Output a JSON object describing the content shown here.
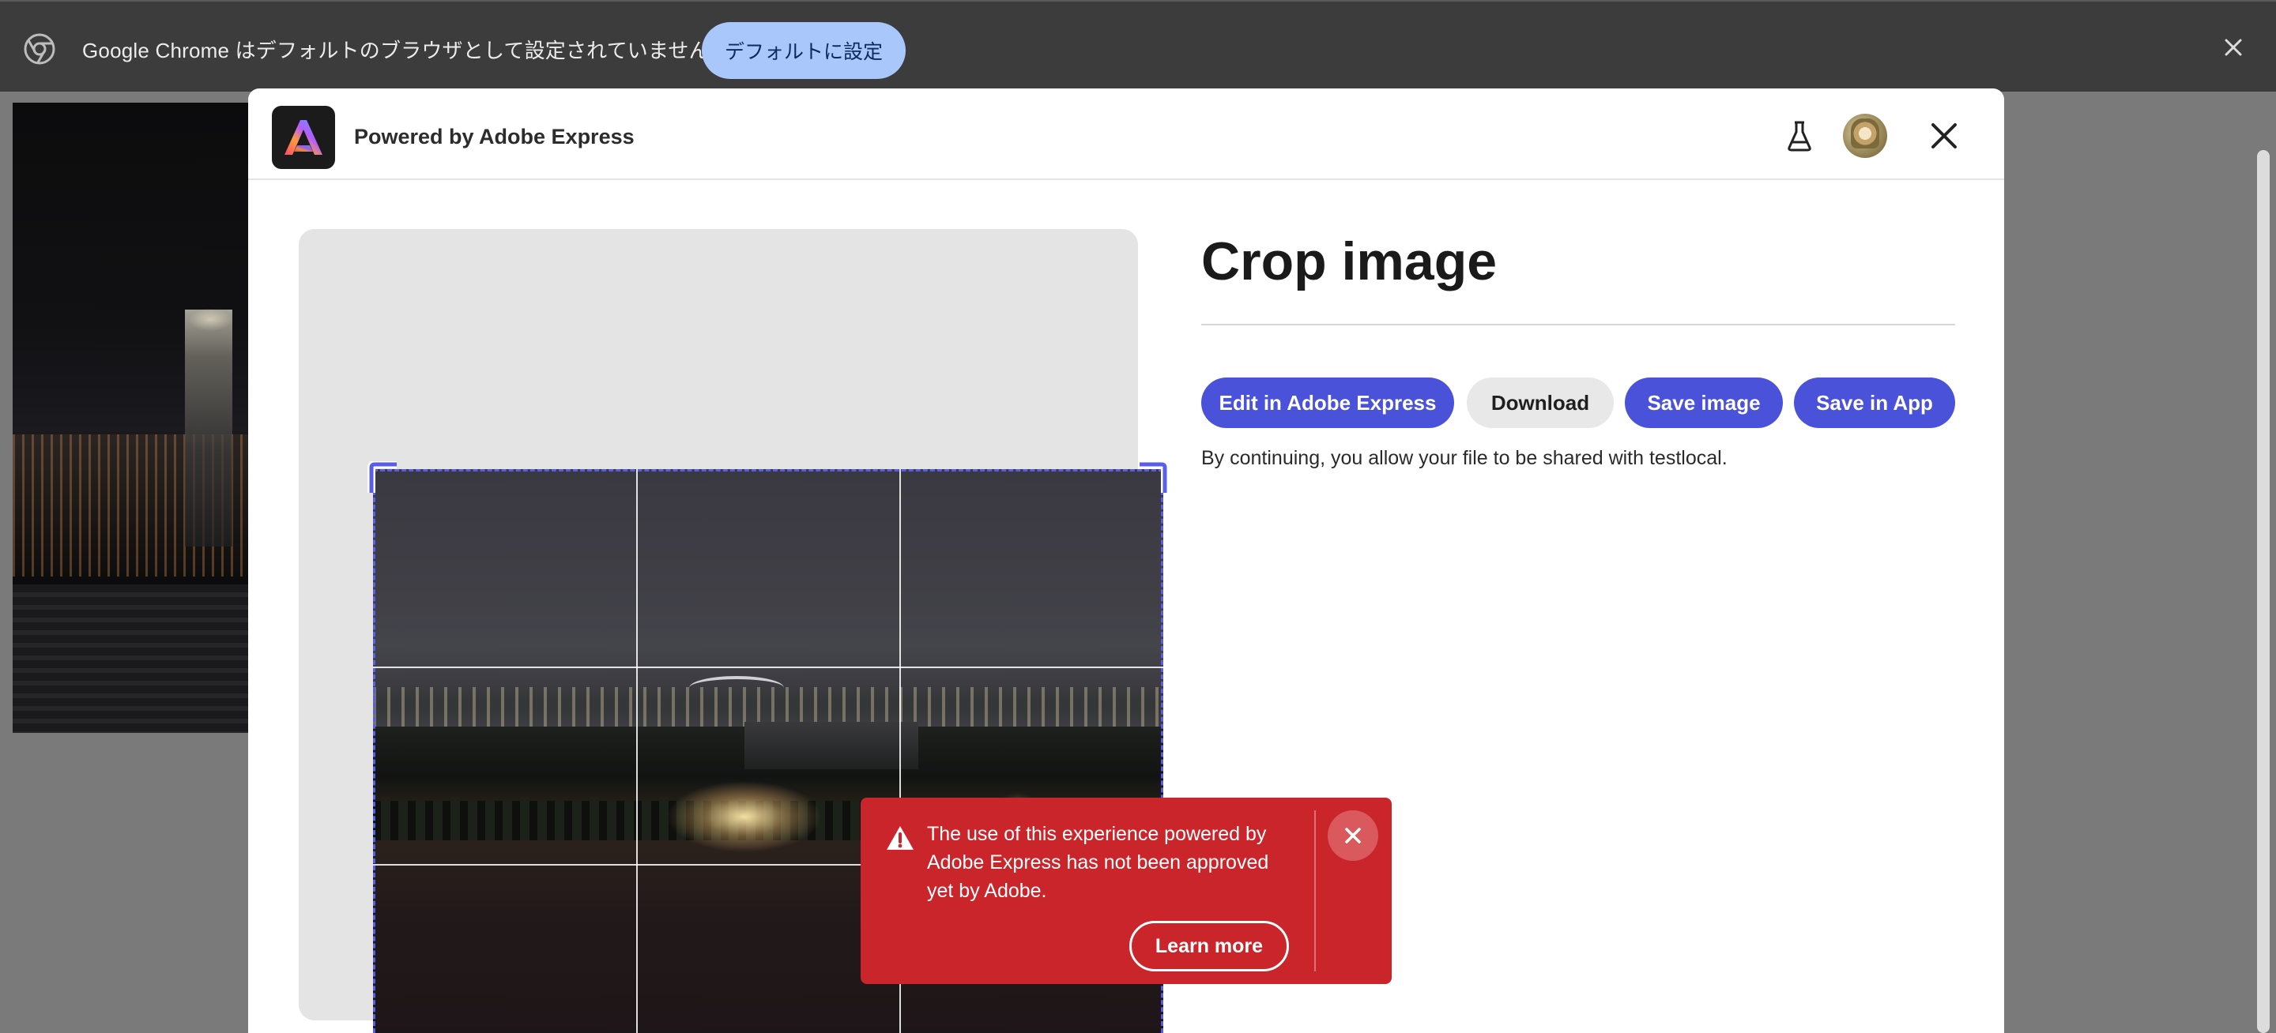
{
  "infobar": {
    "message": "Google Chrome はデフォルトのブラウザとして設定されていません",
    "set_default_label": "デフォルトに設定",
    "icons": {
      "logo": "chrome-logo-icon",
      "close": "close-icon"
    }
  },
  "modal": {
    "header": {
      "powered_by": "Powered by Adobe Express",
      "icons": {
        "logo": "adobe-express-logo-icon",
        "labs": "flask-icon",
        "avatar": "avatar",
        "close": "close-icon"
      }
    },
    "title": "Crop image",
    "actions": {
      "edit_label": "Edit in Adobe Express",
      "download_label": "Download",
      "save_image_label": "Save image",
      "save_in_app_label": "Save in App"
    },
    "consent_text": "By continuing, you allow your file to be shared with testlocal."
  },
  "toast": {
    "message": "The use of this experience powered by Adobe Express has not been approved yet by Adobe.",
    "learn_more_label": "Learn more",
    "icons": {
      "warning": "warning-icon",
      "close": "close-icon"
    }
  },
  "colors": {
    "infobar_bg": "#3c3c3c",
    "infobar_button": "#a9c7fa",
    "primary_button": "#4a52d9",
    "secondary_button": "#e8e8e8",
    "crop_frame": "#5a5de8",
    "toast_bg": "#c9252b"
  }
}
